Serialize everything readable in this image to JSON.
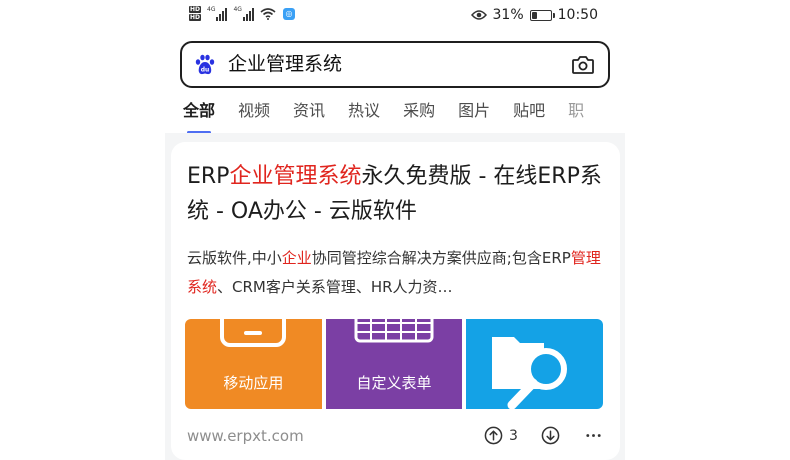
{
  "status_bar": {
    "hd_labels": [
      "HD",
      "HD"
    ],
    "network_labels": [
      "4G",
      "4G"
    ],
    "battery_percent": "31%",
    "battery_level": 0.31,
    "time": "10:50",
    "icons": [
      "signal-icon",
      "wifi-icon",
      "app-notification-icon",
      "eye-icon",
      "battery-icon"
    ]
  },
  "search": {
    "query": "企业管理系统",
    "icons": [
      "baidu-paw-icon",
      "camera-icon"
    ]
  },
  "tabs": [
    {
      "label": "全部",
      "active": true
    },
    {
      "label": "视频"
    },
    {
      "label": "资讯"
    },
    {
      "label": "热议"
    },
    {
      "label": "采购"
    },
    {
      "label": "图片"
    },
    {
      "label": "贴吧"
    },
    {
      "label": "职"
    }
  ],
  "result": {
    "title": {
      "part1": "ERP",
      "part2": "企业管理系统",
      "part3": "永久免费版 - 在线ERP系统 - OA办公 - 云版软件"
    },
    "snippet": {
      "part1": "云版软件,中小",
      "part2": "企业",
      "part3": "协同管控综合解决方案供应商;包含ERP",
      "part4": "管理系统",
      "part5": "、CRM客户关系管理、HR人力资…"
    },
    "images": [
      {
        "label": "移动应用",
        "color": "#f08a24",
        "icon": "mobile-phone-icon"
      },
      {
        "label": "自定义表单",
        "color": "#7b3fa4",
        "icon": "form-grid-icon"
      },
      {
        "label": "",
        "color": "#14a2e6",
        "icon": "folder-search-icon"
      }
    ],
    "site": "www.erpxt.com",
    "upvote_count": "3",
    "highlight_color": "#e0251e"
  },
  "colors": {
    "tab_indicator": "#4e6ef2",
    "baidu_blue": "#2932e1"
  }
}
